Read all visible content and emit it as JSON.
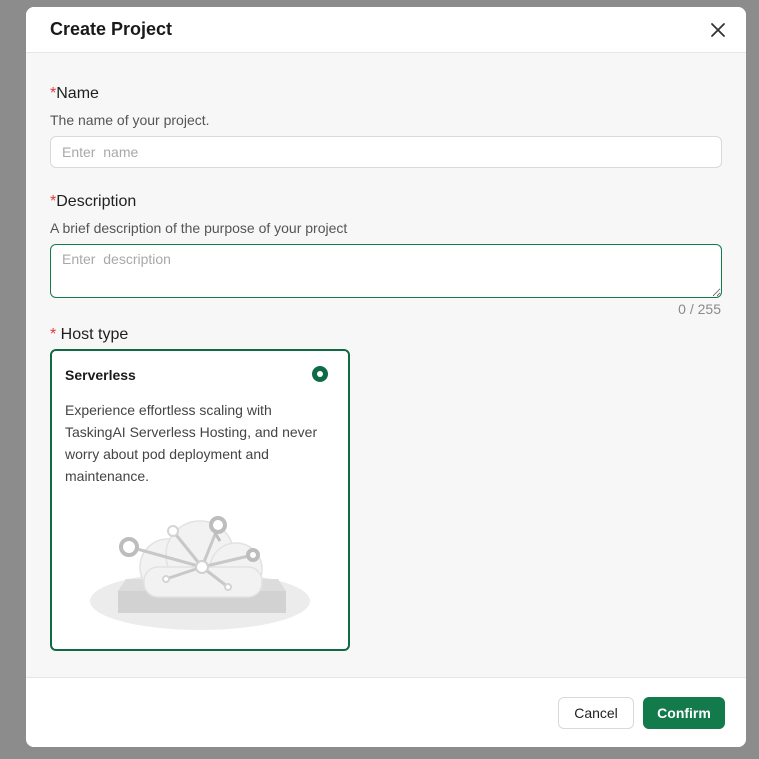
{
  "dialog": {
    "title": "Create Project",
    "close_icon": "close-icon"
  },
  "form": {
    "required_mark": "*",
    "name": {
      "label": "Name",
      "hint": "The name of your project.",
      "placeholder": "Enter  name",
      "value": ""
    },
    "description": {
      "label": "Description",
      "hint": "A brief description of the purpose of your project",
      "placeholder": "Enter  description",
      "value": "",
      "counter": "0 / 255"
    },
    "host_type": {
      "label": " Host type",
      "options": [
        {
          "title": "Serverless",
          "selected": true,
          "description": "Experience effortless scaling with TaskingAI Serverless Hosting, and never worry about pod deployment and maintenance.",
          "illustration_icon": "serverless-cloud-illustration"
        }
      ]
    }
  },
  "footer": {
    "cancel_label": "Cancel",
    "confirm_label": "Confirm"
  },
  "colors": {
    "accent": "#137a4c",
    "accent_dark": "#0f6b45",
    "required": "#e5363f",
    "overlay": "#8c8c8c"
  }
}
